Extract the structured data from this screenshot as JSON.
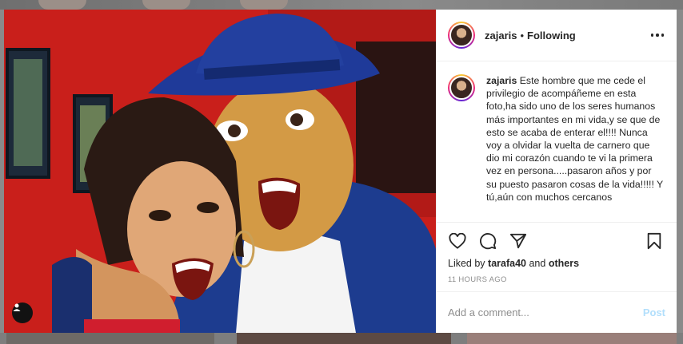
{
  "post": {
    "username": "zajaris",
    "separator": "•",
    "follow_state": "Following",
    "caption_text": "Este hombre que me cede el privilegio de acompáñeme en esta foto,ha sido uno de los seres humanos más importantes en mi vida,y se que de esto se acaba de enterar el!!!! Nunca voy a olvidar la vuelta de carnero que dio mi corazón cuando te vi la primera vez en persona.....pasaron años y por su puesto pasaron cosas de la vida!!!!! Y tú,aún con muchos cercanos",
    "liked_by_prefix": "Liked by",
    "liked_by_user": "tarafa40",
    "liked_by_and": "and",
    "liked_by_others": "others",
    "timestamp": "11 HOURS AGO"
  },
  "comment_box": {
    "placeholder": "Add a comment...",
    "post_label": "Post"
  },
  "icons": {
    "like": "heart-icon",
    "comment": "comment-bubble-icon",
    "share": "paper-plane-icon",
    "save": "bookmark-icon",
    "more": "more-horizontal-icon",
    "tag": "user-tag-icon"
  },
  "colors": {
    "post_button_disabled": "#b2dffc",
    "muted_text": "#8e8e8e",
    "text": "#262626"
  }
}
